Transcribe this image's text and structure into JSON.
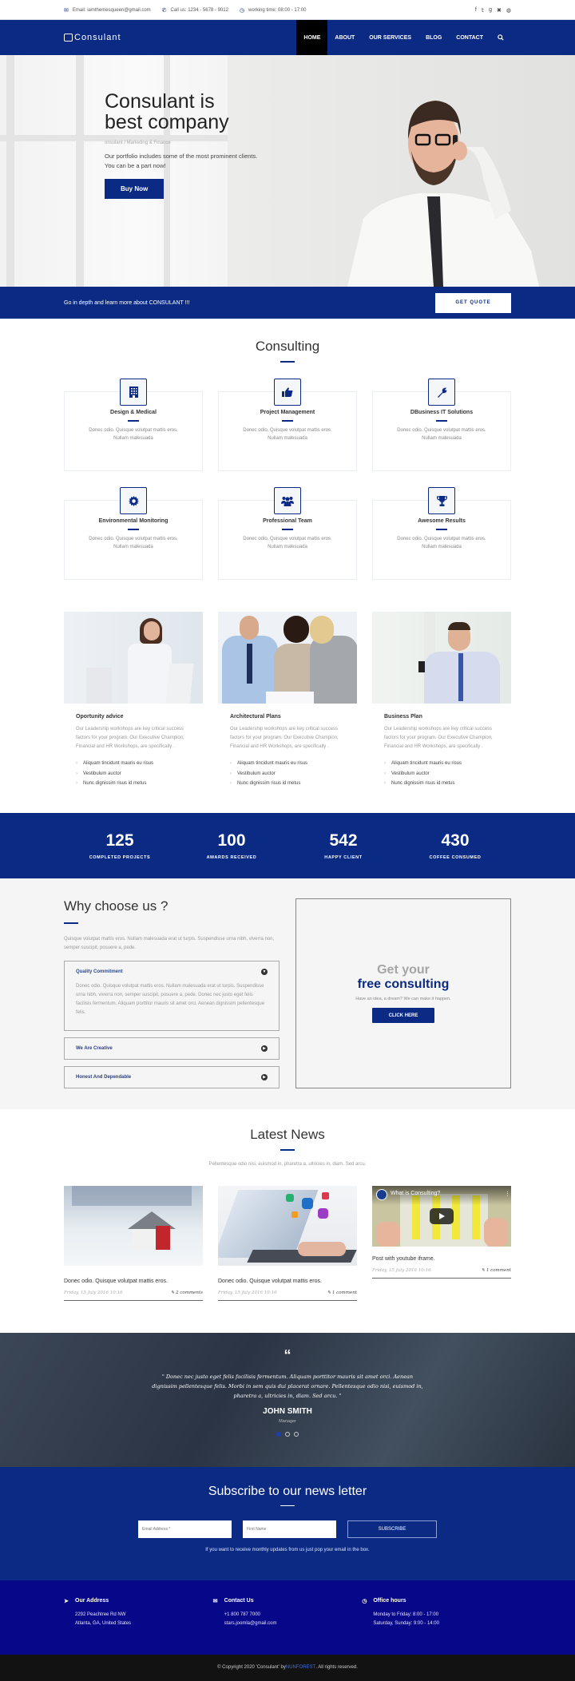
{
  "topbar": {
    "email": "Email: iamthemesqueen@gmail.com",
    "phone": "Call us: 1234 - 5678 - 9012",
    "hours": "working time: 08:00 - 17:00",
    "social": [
      "f",
      "t",
      "g+",
      "x",
      "dribbble"
    ]
  },
  "nav": {
    "logo": "Consulant",
    "items": [
      "HOME",
      "ABOUT",
      "OUR SERVICES",
      "BLOG",
      "CONTACT"
    ],
    "active": "HOME",
    "search_icon": "search-icon"
  },
  "hero": {
    "title_line1": "Consulant is",
    "title_line2": "best company",
    "subtitle": "onsulant / Marketing & Finance",
    "desc_line1": "Our portfolio includes some of the most prominent clients.",
    "desc_line2": "You can be a part now!",
    "button": "Buy Now"
  },
  "quote_strip": {
    "text": "Go in depth and learn more about CONSULANT !!!",
    "button": "GET QUOTE"
  },
  "consulting": {
    "title": "Consulting",
    "cards": [
      {
        "title": "Design & Medical",
        "desc": "Donec odio. Quisque volutpat mattis eros. Nullam malesuada",
        "icon": "building-icon"
      },
      {
        "title": "Project Management",
        "desc": "Donec odio. Quisque volutpat mattis eros. Nullam malesuada",
        "icon": "thumbs-up-icon"
      },
      {
        "title": "DBusiness IT Solutions",
        "desc": "Donec odio. Quisque volutpat mattis eros. Nullam malesuada",
        "icon": "wrench-icon"
      },
      {
        "title": "Environmental Monitoring",
        "desc": "Donec odio. Quisque volutpat mattis eros. Nullam malesuada",
        "icon": "gear-icon"
      },
      {
        "title": "Professional Team",
        "desc": "Donec odio. Quisque volutpat mattis eros. Nullam malesuada",
        "icon": "users-icon"
      },
      {
        "title": "Awesome Results",
        "desc": "Donec odio. Quisque volutpat mattis eros. Nullam malesuada",
        "icon": "trophy-icon"
      }
    ]
  },
  "features": [
    {
      "title": "Oportunity advice",
      "desc": "Our Leadership workshops are key critical success factors for your program. Our Executive Champion, Financial and HR Workshops, are specifically .",
      "list": [
        "Aliquam tincidunt mauris eu risus",
        "Vestibulum auctor",
        "Nunc dignissim risus id metus"
      ]
    },
    {
      "title": "Architectural Plans",
      "desc": "Our Leadership workshops are key critical success factors for your program. Our Executive Champion, Financial and HR Workshops, are specifically .",
      "list": [
        "Aliquam tincidunt mauris eu risus",
        "Vestibulum auctor",
        "Nunc dignissim risus id metus"
      ]
    },
    {
      "title": "Business Plan",
      "desc": "Our Leadership workshops are key critical success factors for your program. Our Executive Champion, Financial and HR Workshops, are specifically .",
      "list": [
        "Aliquam tincidunt mauris eu risus",
        "Vestibulum auctor",
        "Nunc dignissim risus id metus"
      ]
    }
  ],
  "stats": [
    {
      "value": "125",
      "label": "COMPLETED PROJECTS"
    },
    {
      "value": "100",
      "label": "AWARDS RECEIVED"
    },
    {
      "value": "542",
      "label": "HAPPY CLIENT"
    },
    {
      "value": "430",
      "label": "COFFEE CONSUMED"
    }
  ],
  "why": {
    "title": "Why choose us ?",
    "desc": "Quisque volutpat mattis eros. Nullam malesuada erat ut turpis. Suspendisse urna nibh, viverra non, semper suscipit, posuere a, pede.",
    "accordion": [
      {
        "title": "Quality Commitment",
        "body": "Donec odio. Quisque volutpat mattis eros. Nullam malesuada erat ut turpis. Suspendisse urna nibh, viverra non, semper suscipit, posuere a, pede. Donec nec justo eget felis facilisis fermentum. Aliquam porttitor mauris sit amet orci. Aenean dignissim pellentesque felis.",
        "open": true
      },
      {
        "title": "We Are Creative",
        "open": false
      },
      {
        "title": "Honest And Dependable",
        "open": false
      }
    ],
    "cta": {
      "line1": "Get your",
      "line2": "free consulting",
      "desc": "Have an idea, a dream? We can make it happen.",
      "button": "CLICK HERE"
    }
  },
  "news": {
    "title": "Latest News",
    "subtitle": "Pellentesque odio nisi, euismod in, pharetra a, ultricies in, diam. Sed arcu.",
    "posts": [
      {
        "title": "Donec odio. Quisque volutpat mattis eros.",
        "date": "Friday, 15 July 2016 10:16",
        "comments": "2 comments"
      },
      {
        "title": "Donec odio. Quisque volutpat mattis eros.",
        "date": "Friday, 15 July 2016 10:16",
        "comments": "1 comment"
      },
      {
        "title": "Post with youtube iframe.",
        "date": "Friday, 15 July 2016 10:16",
        "comments": "1 comment",
        "video_title": "What is Consulting?"
      }
    ]
  },
  "testimonial": {
    "quote_mark": "“",
    "text": "\" Donec nec justo eget felis facilisis fermentum. Aliquam porttitor mauris sit amet orci. Aenean dignissim pellentesque felis. Morbi in sem quis dui placerat ornare. Pellentesque odio nisi, euismod in, pharetra a, ultricies in, diam. Sed arcu. \"",
    "name": "JOHN SMITH",
    "role": "Manager",
    "slides": 3,
    "active_slide": 1
  },
  "subscribe": {
    "title": "Subscribe to our news letter",
    "email_placeholder": "Email Address *",
    "name_placeholder": "First Name",
    "button": "SUBSCRIBE",
    "note": "If you want to receive monthly updates from us just pop your email in the box."
  },
  "footer": {
    "cols": [
      {
        "title": "Our Address",
        "lines": [
          "2292 Peachtree Rd NW",
          "Atlanta, GA, United States"
        ],
        "icon": "location-arrow-icon"
      },
      {
        "title": "Contact Us",
        "lines": [
          "+1 800 787 7000",
          "stars.joomla@gmail.com"
        ],
        "icon": "envelope-icon"
      },
      {
        "title": "Office hours",
        "lines": [
          "Monday to Friday: 8:00 - 17:00",
          "Saturday, Sunday: 9:00 - 14:00"
        ],
        "icon": "clock-icon"
      }
    ],
    "copyright_pre": "© Copyright 2020 'Consulant' by ",
    "brand": "NUNFOREST",
    "copyright_post": ". All rights reserved."
  },
  "colors": {
    "primary": "#0b2a84",
    "footer": "#07078a",
    "copyright_bg": "#121212"
  }
}
